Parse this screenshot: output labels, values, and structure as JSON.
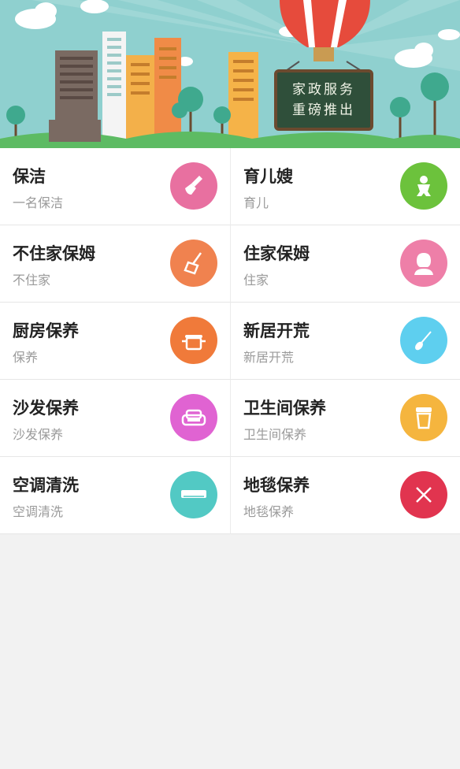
{
  "banner": {
    "line1": "家政服务",
    "line2": "重磅推出"
  },
  "services": [
    {
      "title": "保洁",
      "subtitle": "一名保洁",
      "icon": "broom-icon",
      "color": "#e870a0"
    },
    {
      "title": "育儿嫂",
      "subtitle": "育儿",
      "icon": "baby-icon",
      "color": "#6cc23c"
    },
    {
      "title": "不住家保姆",
      "subtitle": "不住家",
      "icon": "sweeper-icon",
      "color": "#f0824f"
    },
    {
      "title": "住家保姆",
      "subtitle": "住家",
      "icon": "person-icon",
      "color": "#ee7fa8"
    },
    {
      "title": "厨房保养",
      "subtitle": "保养",
      "icon": "pot-icon",
      "color": "#f07a3a"
    },
    {
      "title": "新居开荒",
      "subtitle": "新居开荒",
      "icon": "duster-icon",
      "color": "#5ecfef"
    },
    {
      "title": "沙发保养",
      "subtitle": "沙发保养",
      "icon": "sofa-icon",
      "color": "#e063d2"
    },
    {
      "title": "卫生间保养",
      "subtitle": "卫生间保养",
      "icon": "toilet-icon",
      "color": "#f5b53e"
    },
    {
      "title": "空调清洗",
      "subtitle": "空调清洗",
      "icon": "aircon-icon",
      "color": "#52c9c4"
    },
    {
      "title": "地毯保养",
      "subtitle": "地毯保养",
      "icon": "carpet-icon",
      "color": "#e1344f"
    }
  ]
}
